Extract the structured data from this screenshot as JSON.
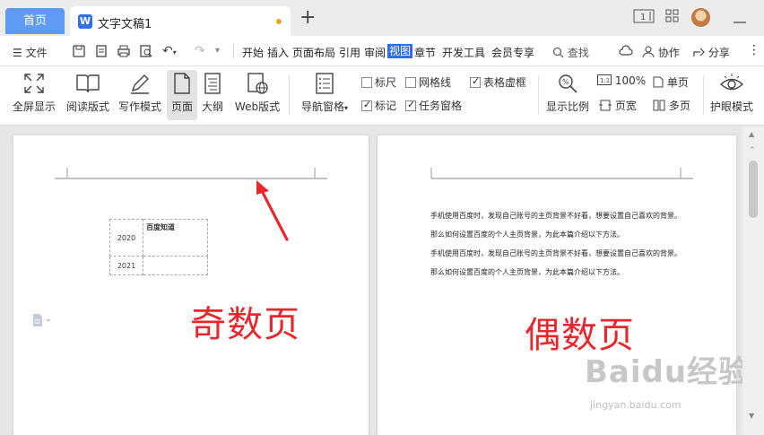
{
  "tabs": {
    "home": "首页",
    "doc_logo": "W",
    "doc_title": "文字文稿1"
  },
  "window": {
    "page_badge": "1"
  },
  "menubar": {
    "file": "文件",
    "items": [
      "开始",
      "插入",
      "页面布局",
      "引用",
      "审阅",
      "视图",
      "章节",
      "开发工具",
      "会员专享"
    ],
    "active": "视图",
    "search": "查找",
    "collab": "协作",
    "share": "分享"
  },
  "ribbon": {
    "fullscreen": "全屏显示",
    "reading": "阅读版式",
    "writing": "写作模式",
    "page": "页面",
    "outline": "大纲",
    "web": "Web版式",
    "nav_pane": "导航窗格",
    "ruler": "标尺",
    "gridlines": "网格线",
    "table_dashed": "表格虚框",
    "marks": "标记",
    "task_pane": "任务窗格",
    "zoom_ratio": "显示比例",
    "zoom_value": "100%",
    "page_width": "页宽",
    "single_page": "单页",
    "multi_page": "多页",
    "eye_mode": "护眼模式",
    "ruler_checked": false,
    "gridlines_checked": false,
    "table_dashed_checked": true,
    "marks_checked": true,
    "task_pane_checked": true
  },
  "odd_page": {
    "table": [
      {
        "year": "2020",
        "note": "百度知道"
      },
      {
        "year": "2021",
        "note": ""
      }
    ],
    "label": "奇数页"
  },
  "even_page": {
    "lines": [
      "手机使用百度时，发现自己账号的主页背景不好看，想要设置自己喜欢的背景。",
      "那么如何设置百度的个人主页背景，为此本篇介绍以下方法。",
      "手机使用百度时，发现自己账号的主页背景不好看，想要设置自己喜欢的背景。",
      "那么如何设置百度的个人主页背景，为此本篇介绍以下方法。"
    ],
    "label": "偶数页"
  },
  "watermark": {
    "brand": "Baidu经验",
    "url": "jingyan.baidu.com"
  },
  "colors": {
    "accent": "#2f6fe8",
    "home_tab": "#5f9bf6",
    "annotation_red": "#e8262c"
  }
}
